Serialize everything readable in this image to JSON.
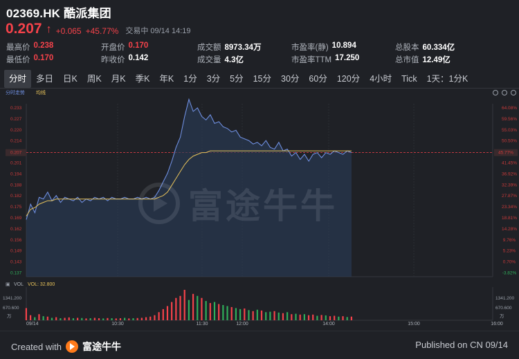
{
  "header": {
    "title": "02369.HK 酷派集团",
    "price": "0.207",
    "arrow": "↑",
    "change": "+0.065",
    "change_pct": "+45.77%",
    "status": "交易中 09/14 14:19"
  },
  "stats": [
    {
      "label": "最高价",
      "value": "0.238",
      "color": "red"
    },
    {
      "label": "开盘价",
      "value": "0.170",
      "color": "red"
    },
    {
      "label": "成交额",
      "value": "8973.34万",
      "color": "white"
    },
    {
      "label": "市盈率(静)",
      "value": "10.894",
      "color": "white"
    },
    {
      "label": "总股本",
      "value": "60.334亿",
      "color": "white"
    },
    {
      "label": "最低价",
      "value": "0.170",
      "color": "red"
    },
    {
      "label": "昨收价",
      "value": "0.142",
      "color": "white"
    },
    {
      "label": "成交量",
      "value": "4.3亿",
      "color": "white"
    },
    {
      "label": "市盈率TTM",
      "value": "17.250",
      "color": "white"
    },
    {
      "label": "总市值",
      "value": "12.49亿",
      "color": "white"
    }
  ],
  "tabs": [
    "分时",
    "多日",
    "日K",
    "周K",
    "月K",
    "季K",
    "年K",
    "1分",
    "3分",
    "5分",
    "15分",
    "30分",
    "60分",
    "120分",
    "4小时",
    "Tick",
    "1天：1分K"
  ],
  "active_tab": 0,
  "legend": {
    "line1": "分时走势",
    "line2": "均线",
    "vol_label": "VOL",
    "vol_value": "VOL: 32.800"
  },
  "colors": {
    "price_line": "#6f8fe0",
    "avg_line": "#e8c35a",
    "up": "#f5424a",
    "down": "#2fae5a",
    "background": "#1f2126"
  },
  "watermark": "富途牛牛",
  "footer": {
    "created": "Created with",
    "brand": "富途牛牛",
    "published": "Published on CN 09/14"
  },
  "chart_data": {
    "type": "line",
    "prev_close": 0.142,
    "last_price": 0.207,
    "last_pct": "45.77%",
    "y_left_ticks": [
      "0.233",
      "0.227",
      "0.220",
      "0.214",
      "0.207",
      "0.201",
      "0.194",
      "0.188",
      "0.182",
      "0.175",
      "0.169",
      "0.162",
      "0.156",
      "0.149",
      "0.143",
      "0.137"
    ],
    "y_right_ticks": [
      "64.08%",
      "59.56%",
      "55.03%",
      "50.50%",
      "45.77%",
      "41.45%",
      "36.92%",
      "32.39%",
      "27.87%",
      "23.34%",
      "18.81%",
      "14.28%",
      "9.76%",
      "5.23%",
      "0.70%",
      "-3.82%"
    ],
    "x_ticks": [
      "09/14",
      "10:30",
      "11:30",
      "12:00",
      "14:00",
      "15:00",
      "16:00"
    ],
    "vol_ticks": [
      "1341.200",
      "670.600",
      "万"
    ],
    "price_series": [
      0.168,
      0.177,
      0.172,
      0.181,
      0.18,
      0.184,
      0.179,
      0.182,
      0.178,
      0.181,
      0.18,
      0.179,
      0.181,
      0.178,
      0.18,
      0.179,
      0.181,
      0.18,
      0.181,
      0.179,
      0.181,
      0.18,
      0.18,
      0.181,
      0.18,
      0.18,
      0.181,
      0.18,
      0.181,
      0.18,
      0.181,
      0.185,
      0.19,
      0.195,
      0.202,
      0.21,
      0.216,
      0.228,
      0.238,
      0.231,
      0.233,
      0.228,
      0.226,
      0.229,
      0.224,
      0.225,
      0.222,
      0.221,
      0.219,
      0.22,
      0.216,
      0.215,
      0.214,
      0.212,
      0.213,
      0.211,
      0.214,
      0.21,
      0.209,
      0.213,
      0.208,
      0.209,
      0.205,
      0.207,
      0.203,
      0.206,
      0.202,
      0.206,
      0.207,
      0.204,
      0.207,
      0.206,
      0.208,
      0.207,
      0.206,
      0.208,
      0.207
    ],
    "avg_series": [
      0.17,
      0.174,
      0.175,
      0.177,
      0.178,
      0.179,
      0.179,
      0.18,
      0.18,
      0.18,
      0.18,
      0.18,
      0.18,
      0.18,
      0.18,
      0.18,
      0.18,
      0.18,
      0.18,
      0.18,
      0.18,
      0.18,
      0.18,
      0.18,
      0.18,
      0.18,
      0.18,
      0.18,
      0.18,
      0.18,
      0.18,
      0.181,
      0.182,
      0.184,
      0.188,
      0.192,
      0.196,
      0.2,
      0.203,
      0.205,
      0.206,
      0.207,
      0.207,
      0.208,
      0.208,
      0.208,
      0.208,
      0.208,
      0.208,
      0.208,
      0.208,
      0.208,
      0.208,
      0.208,
      0.208,
      0.208,
      0.208,
      0.208,
      0.208,
      0.208,
      0.208,
      0.208,
      0.208,
      0.208,
      0.208,
      0.208,
      0.208,
      0.208,
      0.208,
      0.208,
      0.208,
      0.208,
      0.208,
      0.208,
      0.208,
      0.208,
      0.208
    ],
    "volume_series": [
      60,
      25,
      15,
      30,
      20,
      18,
      12,
      15,
      10,
      12,
      14,
      10,
      12,
      11,
      9,
      10,
      12,
      10,
      9,
      11,
      10,
      9,
      10,
      12,
      9,
      10,
      11,
      12,
      15,
      18,
      25,
      40,
      55,
      70,
      90,
      110,
      120,
      150,
      100,
      130,
      120,
      110,
      95,
      85,
      90,
      80,
      75,
      70,
      65,
      60,
      55,
      58,
      50,
      45,
      52,
      48,
      40,
      42,
      45,
      38,
      35,
      40,
      30,
      32,
      28,
      30,
      25,
      28,
      22,
      26,
      24,
      20,
      22,
      18,
      20,
      16,
      18
    ],
    "volume_up": [
      1,
      1,
      0,
      1,
      0,
      1,
      0,
      1,
      0,
      1,
      1,
      0,
      1,
      0,
      1,
      0,
      1,
      1,
      0,
      1,
      0,
      1,
      1,
      0,
      1,
      0,
      1,
      1,
      1,
      1,
      1,
      1,
      1,
      1,
      1,
      1,
      1,
      1,
      0,
      1,
      0,
      1,
      0,
      1,
      0,
      1,
      0,
      0,
      1,
      0,
      0,
      1,
      0,
      1,
      0,
      1,
      0,
      0,
      1,
      0,
      1,
      0,
      1,
      0,
      1,
      0,
      1,
      1,
      0,
      1,
      0,
      1,
      1,
      0,
      1,
      0,
      1
    ]
  }
}
